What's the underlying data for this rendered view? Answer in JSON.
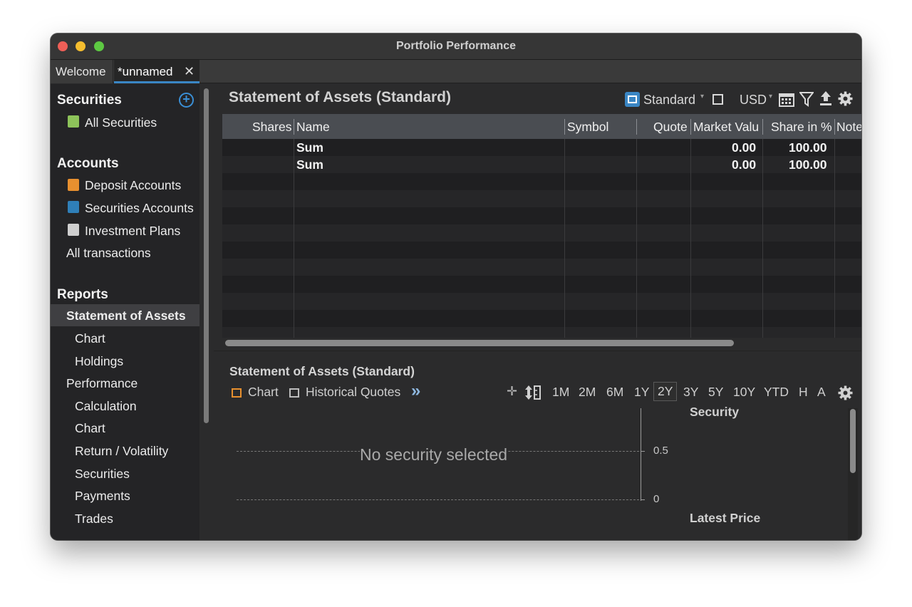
{
  "window": {
    "title": "Portfolio Performance"
  },
  "tabs": [
    {
      "label": "Welcome"
    },
    {
      "label": "*unnamed",
      "close": "✕"
    }
  ],
  "sidebar": {
    "securities_heading": "Securities",
    "add_icon": "+",
    "all_securities": "All Securities",
    "accounts_heading": "Accounts",
    "deposit_accounts": "Deposit Accounts",
    "securities_accounts": "Securities Accounts",
    "investment_plans": "Investment Plans",
    "all_transactions": "All transactions",
    "reports_heading": "Reports",
    "statement_of_assets": "Statement of Assets",
    "chart": "Chart",
    "holdings": "Holdings",
    "performance": "Performance",
    "calculation": "Calculation",
    "perf_chart": "Chart",
    "return_volatility": "Return / Volatility",
    "perf_securities": "Securities",
    "payments": "Payments",
    "trades": "Trades"
  },
  "main": {
    "title": "Statement of Assets (Standard)",
    "toolbar": {
      "view": "Standard",
      "currency": "USD"
    },
    "table": {
      "columns": [
        "Shares",
        "Name",
        "Symbol",
        "Quote",
        "Market Valu",
        "Share in %",
        "Note"
      ],
      "rows": [
        {
          "name": "Sum",
          "market_value": "0.00",
          "share": "100.00"
        },
        {
          "name": "Sum",
          "market_value": "0.00",
          "share": "100.00"
        }
      ]
    }
  },
  "lower": {
    "title": "Statement of Assets (Standard)",
    "tabs": {
      "chart": "Chart",
      "historical_quotes": "Historical Quotes",
      "more": "»"
    },
    "ranges": [
      "1M",
      "2M",
      "6M",
      "1Y",
      "2Y",
      "3Y",
      "5Y",
      "10Y",
      "YTD",
      "H",
      "A"
    ],
    "selected_range": "2Y",
    "chart": {
      "empty_message": "No security selected",
      "ticks": [
        "0.5",
        "0"
      ]
    },
    "info": {
      "security": "Security",
      "latest_price": "Latest Price"
    }
  },
  "colors": {
    "accent": "#3a86c4",
    "deposit_icon": "#e8902f",
    "securities_account_icon": "#2f7fb8",
    "plan_icon": "#cfcfcf",
    "security_icon": "#8dc35a"
  }
}
